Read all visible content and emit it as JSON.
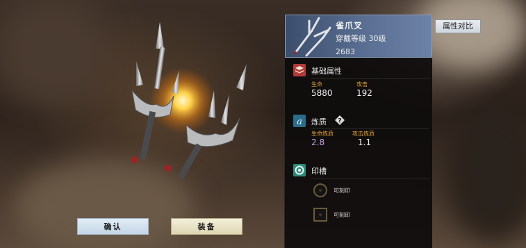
{
  "item": {
    "name": "雀爪叉",
    "level_requirement": "穿戴等级 30级",
    "score": "2683"
  },
  "compare_button": "属性对比",
  "sections": {
    "base": {
      "title": "基础属性",
      "icon": "layers-icon",
      "stats": [
        {
          "label": "生命",
          "value": "5880"
        },
        {
          "label": "攻击",
          "value": "192"
        }
      ]
    },
    "refine": {
      "title": "炼质",
      "icon": "refine-icon",
      "help_icon": "question-icon",
      "stats": [
        {
          "label": "生命炼质",
          "value": "2.8"
        },
        {
          "label": "攻击炼质",
          "value": "1.1"
        }
      ]
    },
    "seal": {
      "title": "印槽",
      "icon": "seal-icon",
      "slots": [
        {
          "label": "可刻印"
        },
        {
          "label": "可刻印"
        }
      ]
    }
  },
  "buttons": {
    "confirm": "确认",
    "equip": "装备"
  },
  "colors": {
    "header_blue": "#5a6f93",
    "stat_label": "#e0a23a",
    "refine_value": "#c9a2e8",
    "base_icon": "#b23a3a",
    "refine_icon": "#2a6d8a",
    "seal_icon": "#2f8a7a"
  }
}
